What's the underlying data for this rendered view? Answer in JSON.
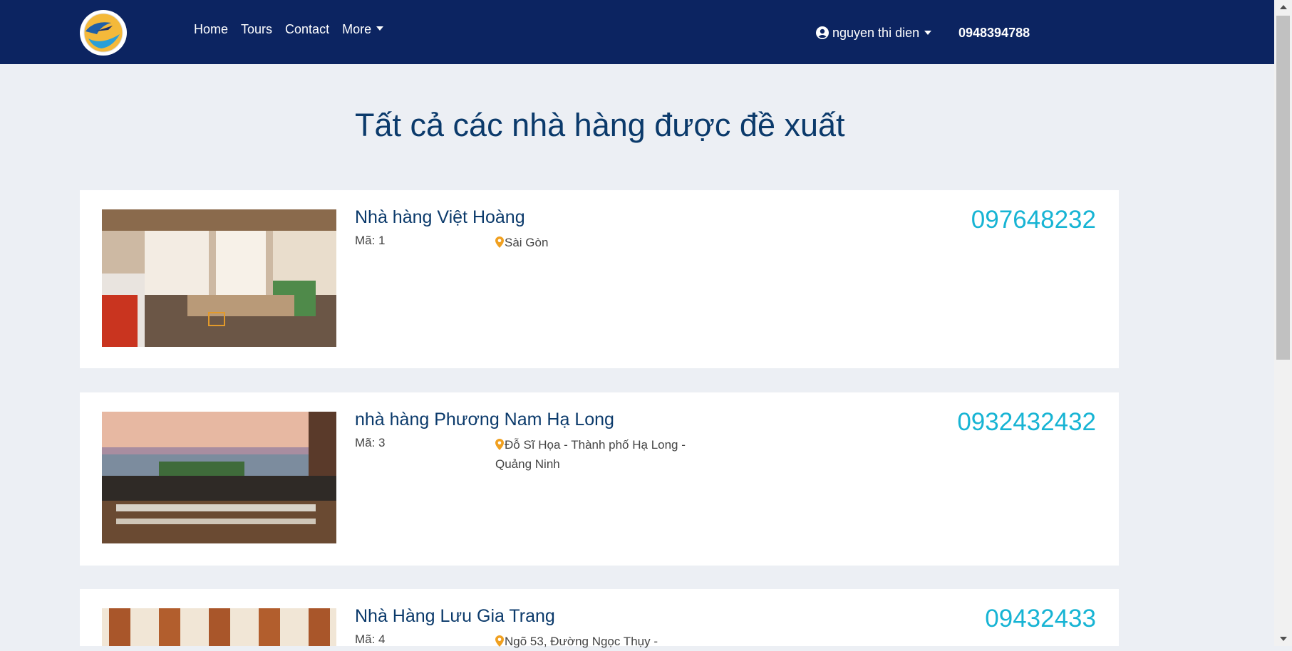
{
  "nav": {
    "links": [
      {
        "label": "Home"
      },
      {
        "label": "Tours"
      },
      {
        "label": "Contact"
      },
      {
        "label": "More"
      }
    ],
    "user_name": "nguyen thi dien",
    "phone": "0948394788"
  },
  "page": {
    "title": "Tất cả các nhà hàng được đề xuất"
  },
  "restaurants": [
    {
      "name": "Nhà hàng Việt Hoàng",
      "code": "Mã: 1",
      "location": "Sài Gòn",
      "phone": "097648232"
    },
    {
      "name": "nhà hàng Phương Nam Hạ Long",
      "code": "Mã: 3",
      "location": "Đỗ Sĩ Họa - Thành phố Hạ Long - Quảng Ninh",
      "phone": "0932432432"
    },
    {
      "name": "Nhà Hàng Lưu Gia Trang",
      "code": "Mã: 4",
      "location": "Ngõ 53, Đường Ngọc Thụy -",
      "phone": "09432433"
    }
  ],
  "colors": {
    "navbar": "#0c2461",
    "title": "#0b3a6b",
    "phone_accent": "#17b4d4",
    "pin": "#f0a020",
    "page_bg": "#eceff4"
  }
}
